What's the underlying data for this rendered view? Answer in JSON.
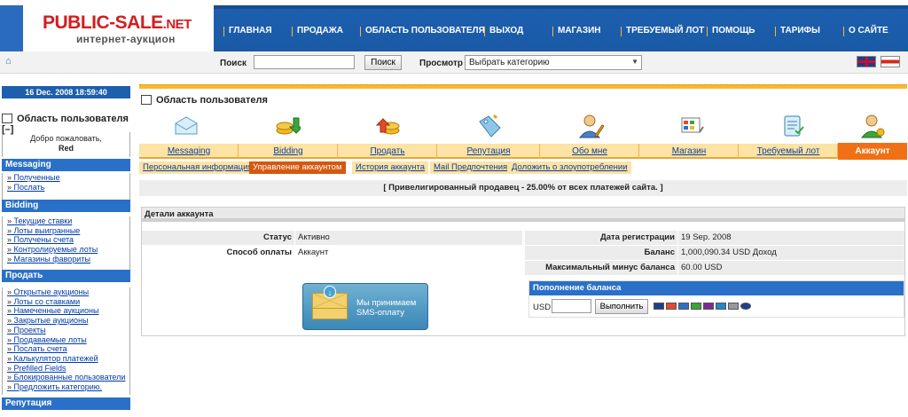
{
  "logo": {
    "brand": "PUBLIC-SALE",
    "tld": ".NET",
    "subtitle": "интернет-аукцион"
  },
  "topnav": [
    "ГЛАВНАЯ",
    "ПРОДАЖА",
    "ОБЛАСТЬ ПОЛЬЗОВАТЕЛЯ",
    "ВЫХОД",
    "МАГАЗИН",
    "ТРЕБУЕМЫЙ ЛОТ",
    "ПОМОЩЬ",
    "ТАРИФЫ",
    "О САЙТЕ"
  ],
  "search": {
    "label": "Поиск",
    "button": "Поиск",
    "browse_label": "Просмотр",
    "category": "Выбрать категорию"
  },
  "sidebar": {
    "date": "16 Dec. 2008 18:59:40",
    "area_title": "Область пользователя [–]",
    "welcome": "Добро пожаловать,",
    "username": "Red",
    "sections": [
      {
        "title": "Messaging",
        "links": [
          "Полученные",
          "Послать"
        ]
      },
      {
        "title": "Bidding",
        "links": [
          "Текущие ставки",
          "Лоты выигранные",
          "Получены счета",
          "Контролируемые лоты",
          "Магазины фавориты"
        ]
      },
      {
        "title": "Продать",
        "links": [
          "Открытые аукционы",
          "Лоты со ставками",
          "Намеченные аукционы",
          "Закрытые аукционы",
          "Проекты",
          "Продаваемые лоты",
          "Послать счета",
          "Калькулятор платежей",
          "Prefilled Fields",
          "Блокированные пользователи",
          "Предложить категорию."
        ]
      },
      {
        "title": "Репутация",
        "links": []
      }
    ]
  },
  "main": {
    "page_title": "Область пользователя",
    "tabs": [
      "Messaging",
      "Bidding",
      "Продать",
      "Репутация",
      "Обо мне",
      "Магазин",
      "Требуемый лот",
      "Аккаунт"
    ],
    "subtabs": [
      "Персональная информация",
      "Управление аккаунтом",
      "История аккаунта",
      "Mail Предпочтения",
      "Доложить о злоупотреблении"
    ],
    "notice": "[ Привелигированный продавец - 25.00% от всех платежей сайта. ]",
    "details": {
      "title": "Детали аккаунта",
      "status_label": "Статус",
      "status_value": "Активно",
      "payment_label": "Способ оплаты",
      "payment_value": "Аккаунт",
      "reg_label": "Дата регистрации",
      "reg_value": "19 Sep. 2008",
      "balance_label": "Баланс",
      "balance_value": "1,000,090.34 USD Доход",
      "max_minus_label": "Максимальный минус баланса",
      "max_minus_value": "60.00 USD"
    },
    "sms": {
      "line1": "Мы принимаем",
      "line2": "SMS-оплату"
    },
    "topup": {
      "title": "Пополнение баланса",
      "currency": "USD",
      "button": "Выполнить"
    }
  },
  "colors": {
    "nav_blue": "#1d5fae",
    "accent_orange": "#f07015",
    "tab_yellow": "#fde3a4"
  }
}
